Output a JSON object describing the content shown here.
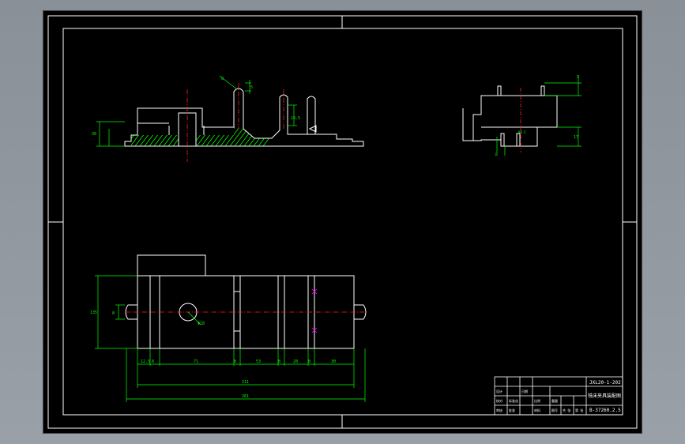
{
  "colors": {
    "background": "#000000",
    "outline": "#ffffff",
    "dimension": "#00ff00",
    "centerline": "#ff2020",
    "hatch": "#00ff00",
    "hole_mark": "#ff00ff"
  },
  "front_view": {
    "dims": {
      "top_right_a": "8",
      "top_right_b": "5",
      "slot_depth": "10.5",
      "left_height": "30"
    }
  },
  "side_view": {
    "dims": {
      "top": "3",
      "right": "17",
      "center": "R8.5",
      "bottom": "1"
    }
  },
  "top_view": {
    "dims": {
      "left_height": "135",
      "slot_width": "8",
      "hole_label": "Φ18",
      "segments": [
        "12.5",
        "8",
        "71",
        "8",
        "53",
        "8",
        "28",
        "8",
        "30"
      ],
      "overall_inner": "211",
      "overall": "261"
    }
  },
  "title_block": {
    "part_name": "JXL20-1-202",
    "drawing_name": "铣床夹具装配图",
    "code": "B-37260.2.5",
    "cells": [
      "设计",
      "校对",
      "审核",
      "标准化",
      "日期",
      "批准",
      "比例",
      "重量",
      "共 张",
      "第 张",
      "图号",
      "材料"
    ]
  }
}
